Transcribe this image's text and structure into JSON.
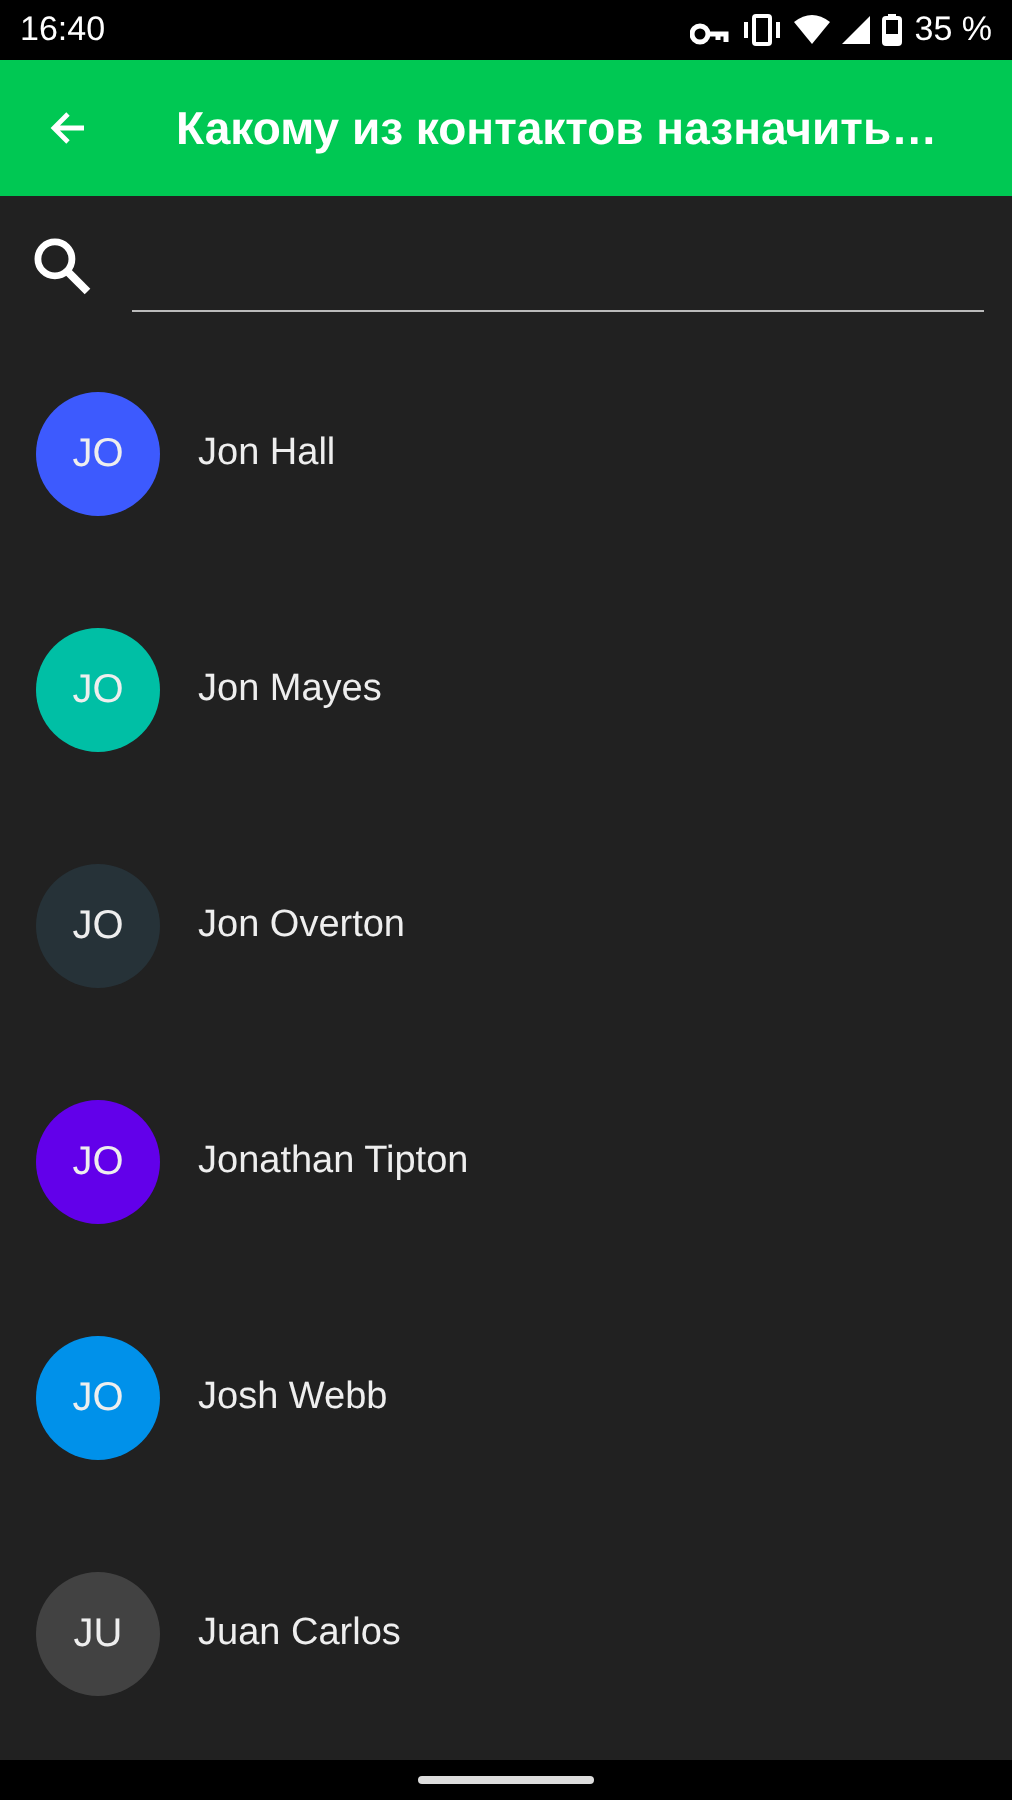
{
  "status_bar": {
    "time": "16:40",
    "battery": "35 %"
  },
  "app_bar": {
    "title": "Какому из контактов назначить…"
  },
  "contacts": [
    {
      "initials": "JO",
      "name": "Jon Hall",
      "color": "#3d5afe"
    },
    {
      "initials": "JO",
      "name": "Jon Mayes",
      "color": "#00bfa5"
    },
    {
      "initials": "JO",
      "name": "Jon Overton",
      "color": "#263238"
    },
    {
      "initials": "JO",
      "name": "Jonathan Tipton",
      "color": "#6200ea"
    },
    {
      "initials": "JO",
      "name": "Josh Webb",
      "color": "#0091ea"
    },
    {
      "initials": "JU",
      "name": "Juan Carlos",
      "color": "#424242"
    }
  ]
}
